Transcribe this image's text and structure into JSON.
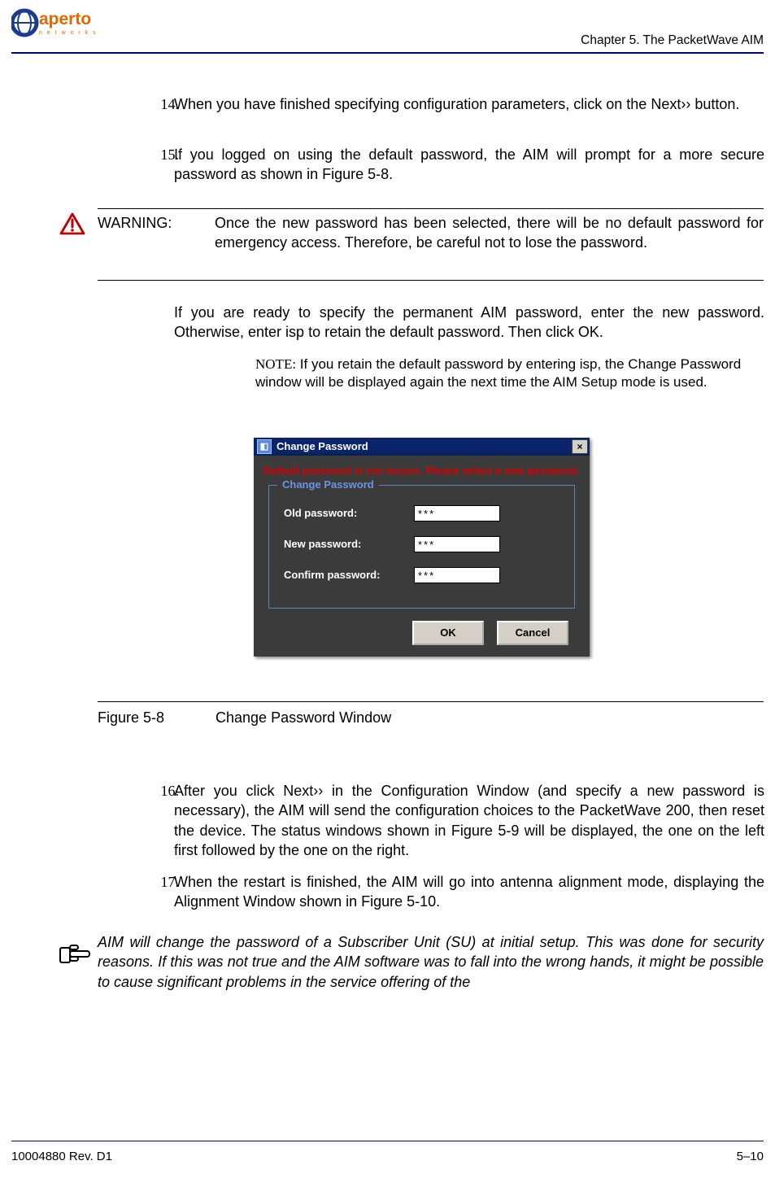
{
  "header": {
    "chapter": "Chapter 5.  The PacketWave AIM",
    "logo_top": "aperto",
    "logo_sub": "n e t w o r k s"
  },
  "steps": {
    "s14": {
      "num": "14.",
      "text": "When you have finished specifying configuration parameters, click on the Next›› button."
    },
    "s15": {
      "num": "15.",
      "text": "If you logged on using the default password, the AIM will prompt for a more secure password as shown in Figure 5-8."
    },
    "s16": {
      "num": "16.",
      "text": "After you click Next›› in the Configuration Window (and specify a new password is necessary), the AIM will send the configuration choices to the PacketWave 200, then reset the device. The status windows shown in Figure 5-9 will be displayed, the one on the left first followed by the one on the right."
    },
    "s17": {
      "num": "17.",
      "text": "When the restart is finished, the AIM will go into antenna alignment mode, displaying the Alignment Window shown in Figure 5-10."
    }
  },
  "warning": {
    "label": "WARNING:",
    "text": "Once the new password has been selected, there will be no default password for emergency access. Therefore, be careful not to lose the password."
  },
  "after_warning": "If you are ready to specify the permanent AIM password, enter the new password. Otherwise, enter isp to retain the default password. Then click OK.",
  "note": {
    "label": "NOTE:",
    "text": "If you retain the default password by entering isp, the Change Password window will be displayed again the next time the AIM Setup mode is used."
  },
  "dialog": {
    "title": "Change Password",
    "close": "×",
    "warning_line": "Default password is not secure. Please select a new password.",
    "legend": "Change Password",
    "fields": {
      "old": {
        "label": "Old password:",
        "value": "***"
      },
      "new": {
        "label": "New password:",
        "value": "***"
      },
      "confirm": {
        "label": "Confirm password:",
        "value": "***"
      }
    },
    "buttons": {
      "ok": "OK",
      "cancel": "Cancel"
    }
  },
  "figure": {
    "num": "Figure 5-8",
    "title": "Change Password Window"
  },
  "hand_note": "AIM will change the password of a Subscriber Unit (SU) at initial setup. This was done for security reasons. If this was not true and the AIM software was to fall into the wrong hands, it might be possible to cause significant problems in the service offering of the",
  "footer": {
    "left": "10004880 Rev. D1",
    "right": "5–10"
  }
}
